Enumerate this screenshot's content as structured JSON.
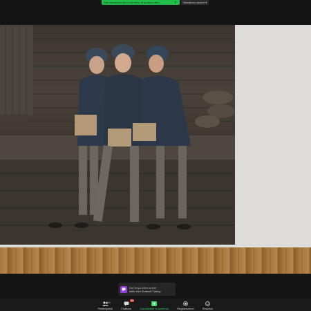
{
  "banner": {
    "sharing_text": "Stai visualizzando lo schermo di qualcun altro",
    "view_options_label": "Visualizza opzioni",
    "close_glyph": "×"
  },
  "chat_toast": {
    "sender_line": "Da Derya  a/ken a tutti",
    "message": "hello from Edremit Turkey",
    "avatar_color": "#8e3fd6"
  },
  "toolbar": {
    "participants_label": "Partecipanti",
    "participants_count": "144",
    "chat_label": "Chattare",
    "chat_badge": "64",
    "share_label": "Condividere lo schermo",
    "record_label": "Registrazione",
    "reactions_label": "Reazioni",
    "share_color": "#3ddc6a"
  },
  "icons": [
    "participants-icon",
    "chat-icon",
    "share-screen-icon",
    "record-icon",
    "reactions-icon",
    "chevron-down-icon"
  ]
}
